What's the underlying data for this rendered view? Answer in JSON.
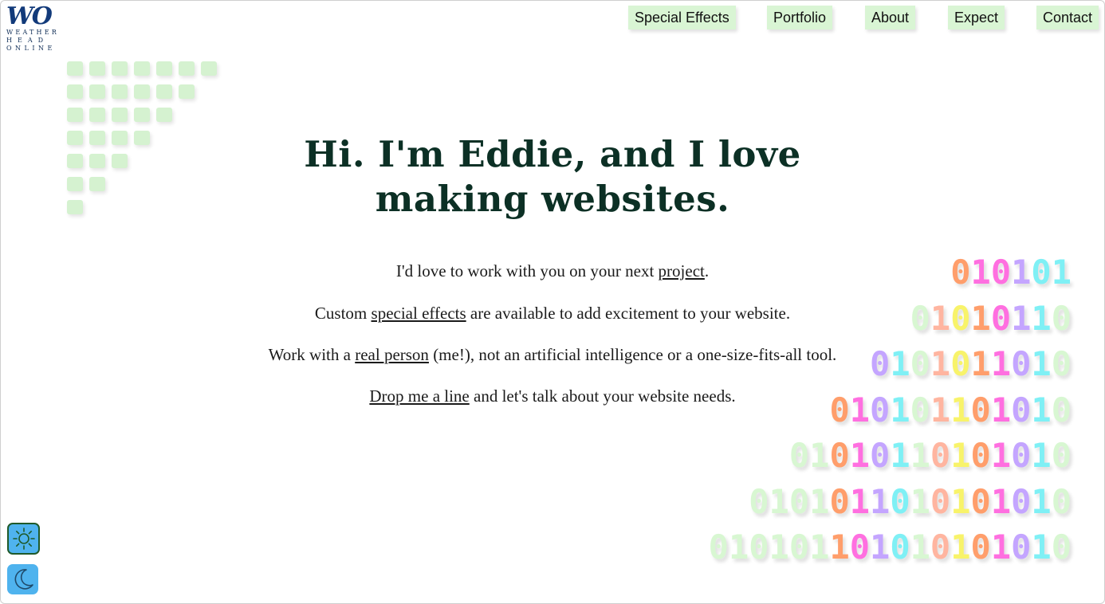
{
  "logo": {
    "mark": "WO",
    "lines": [
      "WEATHER",
      "HEAD",
      "ONLINE"
    ]
  },
  "nav": {
    "items": [
      {
        "label": "Special Effects"
      },
      {
        "label": "Portfolio"
      },
      {
        "label": "About"
      },
      {
        "label": "Expect"
      },
      {
        "label": "Contact"
      }
    ]
  },
  "hero": {
    "headline": "Hi. I'm Eddie, and I love making websites.",
    "p1": {
      "before": "I'd love to work with you on your next ",
      "link": "project",
      "after": "."
    },
    "p2": {
      "before": "Custom ",
      "link": "special effects",
      "after": " are available to add excitement to your website."
    },
    "p3": {
      "before": "Work with a ",
      "link": "real person",
      "after": " (me!), not an artificial intelligence or a one-size-fits-all tool."
    },
    "p4": {
      "before": "",
      "link": "Drop me a line",
      "after": " and let's talk about your website needs."
    }
  },
  "binary_art": {
    "rows": [
      "010101",
      "01010110",
      "0101011010",
      "010101101010",
      "01010110101010",
      "0101011010101010",
      "010101101010101010"
    ],
    "colors": [
      "#ff9e6b",
      "#ff6fe0",
      "#c4a5ff",
      "#7ff0f5",
      "#f8f36a",
      "#ffb5a0",
      "#d8f7d2"
    ]
  },
  "theme": {
    "light_label": "light mode",
    "dark_label": "dark mode",
    "accent": "#4fb3ee"
  }
}
